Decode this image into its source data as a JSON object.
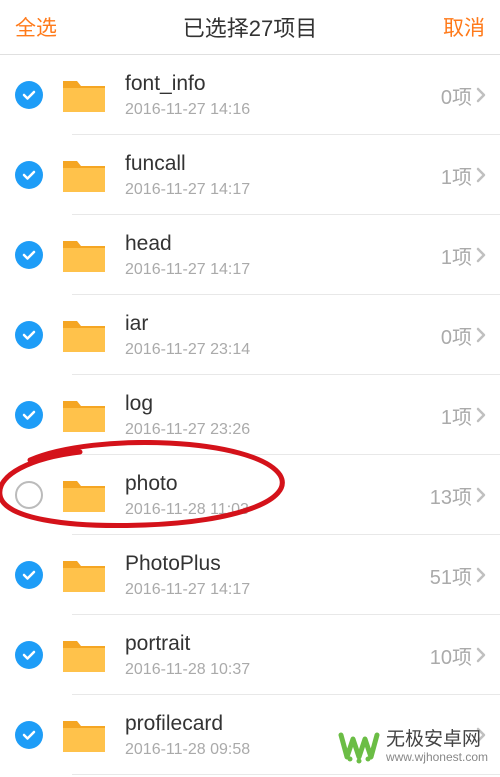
{
  "header": {
    "select_all": "全选",
    "title": "已选择27项目",
    "cancel": "取消"
  },
  "items": [
    {
      "name": "font_info",
      "date": "2016-11-27 14:16",
      "count": "0项",
      "checked": true
    },
    {
      "name": "funcall",
      "date": "2016-11-27 14:17",
      "count": "1项",
      "checked": true
    },
    {
      "name": "head",
      "date": "2016-11-27 14:17",
      "count": "1项",
      "checked": true
    },
    {
      "name": "iar",
      "date": "2016-11-27 23:14",
      "count": "0项",
      "checked": true
    },
    {
      "name": "log",
      "date": "2016-11-27 23:26",
      "count": "1项",
      "checked": true
    },
    {
      "name": "photo",
      "date": "2016-11-28 11:03",
      "count": "13项",
      "checked": false
    },
    {
      "name": "PhotoPlus",
      "date": "2016-11-27 14:17",
      "count": "51项",
      "checked": true
    },
    {
      "name": "portrait",
      "date": "2016-11-28 10:37",
      "count": "10项",
      "checked": true
    },
    {
      "name": "profilecard",
      "date": "2016-11-28 09:58",
      "count": "",
      "checked": true
    }
  ],
  "watermark": {
    "title": "无极安卓网",
    "url": "www.wjhonest.com"
  },
  "colors": {
    "accent": "#ff7a1a",
    "check": "#1e9df7",
    "folder_light": "#ffc24b",
    "folder_dark": "#f5a623",
    "annotation": "#d4121a",
    "logo": "#6bbd45"
  }
}
